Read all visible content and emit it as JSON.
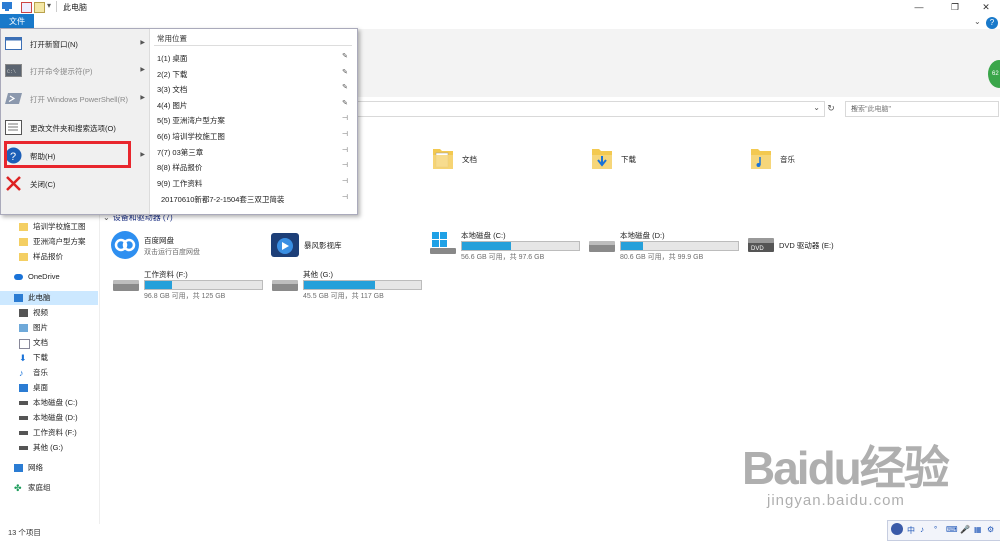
{
  "window": {
    "title": "此电脑",
    "controls": [
      "—",
      "❐",
      "✕"
    ]
  },
  "ribbon": {
    "file_tab": "文件"
  },
  "search": {
    "placeholder": "搜索\"此电脑\""
  },
  "file_menu": {
    "items": [
      {
        "label": "打开新窗口(N)",
        "icon": "new-window-icon",
        "has_arrow": true,
        "disabled": false
      },
      {
        "label": "打开命令提示符(P)",
        "icon": "cmd-icon",
        "has_arrow": true,
        "disabled": true
      },
      {
        "label": "打开 Windows PowerShell(R)",
        "icon": "powershell-icon",
        "has_arrow": true,
        "disabled": true
      },
      {
        "label": "更改文件夹和搜索选项(O)",
        "icon": "folder-options-icon",
        "has_arrow": false,
        "disabled": false
      },
      {
        "label": "帮助(H)",
        "icon": "help-icon",
        "has_arrow": true,
        "disabled": false
      },
      {
        "label": "关闭(C)",
        "icon": "close-icon",
        "has_arrow": false,
        "disabled": false
      }
    ],
    "recent_title": "常用位置",
    "recent": [
      {
        "label": "1(1) 桌面",
        "pin": "pinned"
      },
      {
        "label": "2(2) 下载",
        "pin": "pinned"
      },
      {
        "label": "3(3) 文档",
        "pin": "pinned"
      },
      {
        "label": "4(4) 图片",
        "pin": "pinned"
      },
      {
        "label": "5(5) 亚洲湾户型方案",
        "pin": "unpinned"
      },
      {
        "label": "6(6) 培训学校施工图",
        "pin": "unpinned"
      },
      {
        "label": "7(7) 03第三章",
        "pin": "unpinned"
      },
      {
        "label": "8(8) 样品报价",
        "pin": "unpinned"
      },
      {
        "label": "9(9) 工作资料",
        "pin": "unpinned"
      },
      {
        "label": "20170610新都7-2-1504套三双卫简装",
        "pin": "unpinned"
      }
    ]
  },
  "nav": {
    "items": [
      {
        "label": "培训学校施工图",
        "icon": "folder-icon"
      },
      {
        "label": "亚洲湾户型方案",
        "icon": "folder-icon"
      },
      {
        "label": "样品报价",
        "icon": "folder-icon"
      },
      {
        "label": "OneDrive",
        "icon": "cloud-icon"
      },
      {
        "label": "此电脑",
        "icon": "pc-icon"
      },
      {
        "label": "视频",
        "icon": "video-icon"
      },
      {
        "label": "图片",
        "icon": "picture-icon"
      },
      {
        "label": "文档",
        "icon": "document-icon"
      },
      {
        "label": "下载",
        "icon": "download-icon"
      },
      {
        "label": "音乐",
        "icon": "music-icon"
      },
      {
        "label": "桌面",
        "icon": "desktop-icon"
      },
      {
        "label": "本地磁盘 (C:)",
        "icon": "drive-icon"
      },
      {
        "label": "本地磁盘 (D:)",
        "icon": "drive-icon"
      },
      {
        "label": "工作资料 (F:)",
        "icon": "drive-icon"
      },
      {
        "label": "其他 (G:)",
        "icon": "drive-icon"
      },
      {
        "label": "网络",
        "icon": "network-icon"
      },
      {
        "label": "家庭组",
        "icon": "homegroup-icon"
      }
    ]
  },
  "folders": [
    {
      "label": "文档",
      "icon": "document-folder-icon"
    },
    {
      "label": "下载",
      "icon": "download-folder-icon"
    },
    {
      "label": "音乐",
      "icon": "music-folder-icon"
    }
  ],
  "devices": {
    "heading": "设备和驱动器 (7)",
    "items": [
      {
        "label": "百度网盘",
        "sub": "双击运行百度网盘",
        "icon": "baidu-netdisk-icon"
      },
      {
        "label": "暴风影视库",
        "icon": "storm-video-icon"
      },
      {
        "label": "本地磁盘 (C:)",
        "sub": "56.6 GB 可用，共 97.6 GB",
        "used_fraction": 0.42,
        "icon": "windows-drive-icon"
      },
      {
        "label": "本地磁盘 (D:)",
        "sub": "80.6 GB 可用，共 99.9 GB",
        "used_fraction": 0.19,
        "icon": "drive-icon"
      },
      {
        "label": "DVD 驱动器 (E:)",
        "icon": "dvd-drive-icon"
      },
      {
        "label": "工作资料 (F:)",
        "sub": "96.8 GB 可用，共 125 GB",
        "used_fraction": 0.23,
        "icon": "drive-icon"
      },
      {
        "label": "其他 (G:)",
        "sub": "45.5 GB 可用，共 117 GB",
        "used_fraction": 0.61,
        "icon": "drive-icon"
      }
    ]
  },
  "status": {
    "count": "13 个项目"
  },
  "ime": {
    "items": [
      "中",
      "♪",
      "°",
      "⌨",
      "🎤",
      "▦",
      "⚙"
    ]
  },
  "watermark": {
    "brand": "Baidu经验",
    "url": "jingyan.baidu.com"
  },
  "colors": {
    "accent": "#1979ca",
    "highlight": "#e8262d",
    "capacity_fill": "#26a0da",
    "selected_nav": "#cce8ff"
  }
}
